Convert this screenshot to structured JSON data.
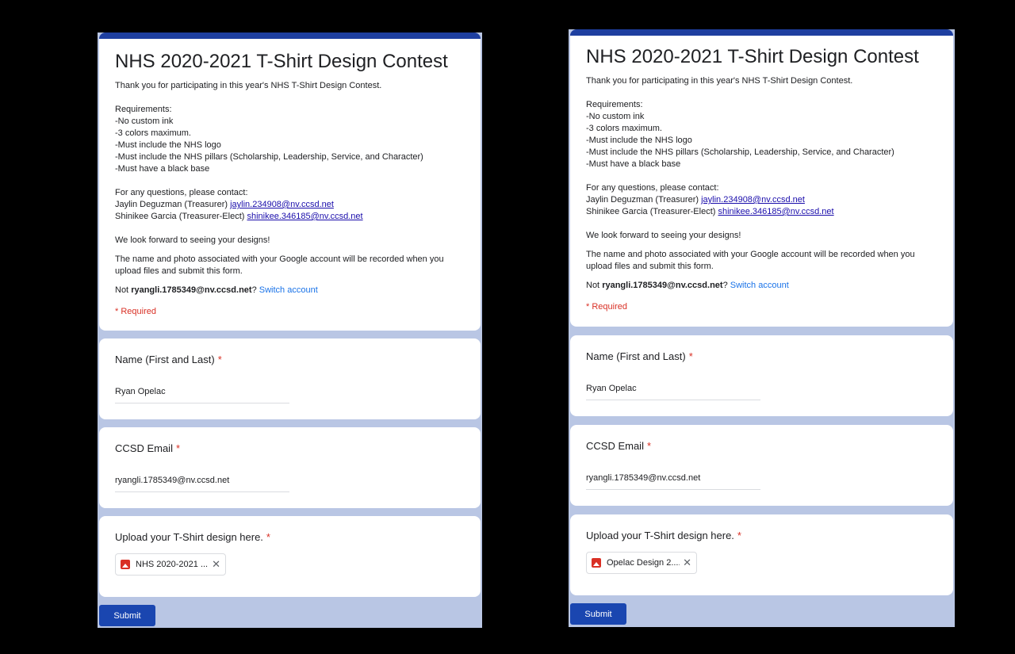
{
  "form_left": {
    "title": "NHS 2020-2021 T-Shirt Design Contest",
    "intro": "Thank you for participating in this year's NHS T-Shirt Design Contest.",
    "requirements_heading": "Requirements:",
    "requirements": [
      "-No custom ink",
      "-3 colors maximum.",
      "-Must include the NHS logo",
      "-Must include the NHS pillars (Scholarship, Leadership, Service, and Character)",
      "-Must have a black base"
    ],
    "contact_heading": "For any questions, please contact:",
    "contacts": [
      {
        "name": "Jaylin Deguzman (Treasurer)",
        "email": "jaylin.234908@nv.ccsd.net"
      },
      {
        "name": "Shinikee Garcia (Treasurer-Elect)",
        "email": "shinikee.346185@nv.ccsd.net"
      }
    ],
    "closing": "We look forward to seeing your designs!",
    "privacy_note": "The name and photo associated with your Google account will be recorded when you upload files and submit this form.",
    "not_prefix": "Not",
    "account": "ryangli.1785349@nv.ccsd.net",
    "not_suffix": "?",
    "switch_account": "Switch account",
    "required_note": "* Required",
    "q_name": "Name (First and Last)",
    "a_name": "Ryan Opelac",
    "q_email": "CCSD Email",
    "a_email": "ryangli.1785349@nv.ccsd.net",
    "q_upload": "Upload your T-Shirt design here.",
    "file_name": "NHS 2020-2021 ...",
    "star": "*",
    "submit": "Submit"
  },
  "form_right": {
    "title": "NHS 2020-2021 T-Shirt Design Contest",
    "intro": "Thank you for participating in this year's NHS T-Shirt Design Contest.",
    "requirements_heading": "Requirements:",
    "requirements": [
      "-No custom ink",
      "-3 colors maximum.",
      "-Must include the NHS logo",
      "-Must include the NHS pillars (Scholarship, Leadership, Service, and Character)",
      "-Must have a black base"
    ],
    "contact_heading": "For any questions, please contact:",
    "contacts": [
      {
        "name": "Jaylin Deguzman (Treasurer)",
        "email": "jaylin.234908@nv.ccsd.net"
      },
      {
        "name": "Shinikee Garcia (Treasurer-Elect)",
        "email": "shinikee.346185@nv.ccsd.net"
      }
    ],
    "closing": "We look forward to seeing your designs!",
    "privacy_note": "The name and photo associated with your Google account will be recorded when you upload files and submit this form.",
    "not_prefix": "Not",
    "account": "ryangli.1785349@nv.ccsd.net",
    "not_suffix": "?",
    "switch_account": "Switch account",
    "required_note": "* Required",
    "q_name": "Name (First and Last)",
    "a_name": "Ryan Opelac",
    "q_email": "CCSD Email",
    "a_email": "ryangli.1785349@nv.ccsd.net",
    "q_upload": "Upload your T-Shirt design here.",
    "file_name": "Opelac Design 2....",
    "star": "*",
    "submit": "Submit"
  },
  "colors": {
    "background": "#000000",
    "form_bg": "#b9c6e4",
    "header_accent": "#1e3fa0",
    "required": "#d93025",
    "link": "#1a0dab",
    "switch_link": "#1a73e8",
    "submit_bg": "#1a46b0"
  },
  "icons": {
    "file": "image-file-icon",
    "remove": "close-icon"
  }
}
